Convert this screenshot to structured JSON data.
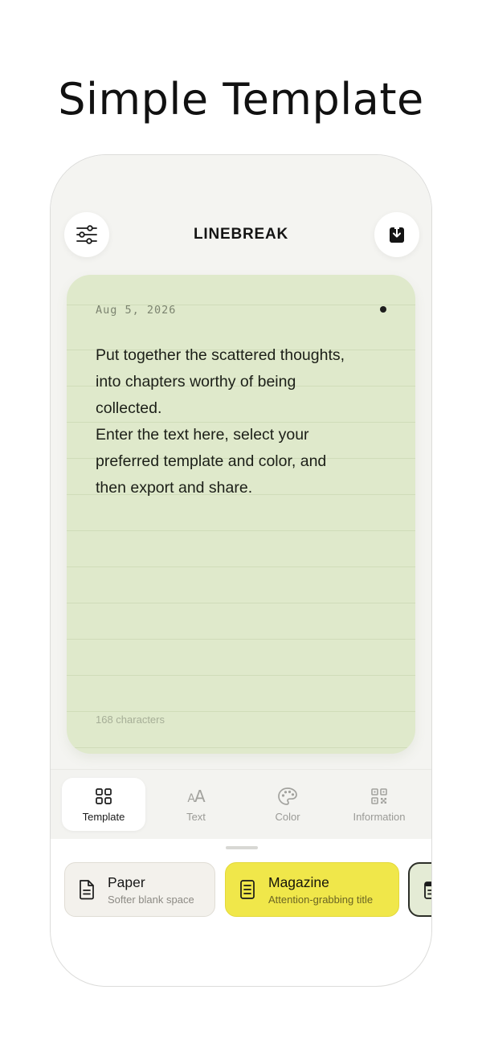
{
  "headline": "Simple Template",
  "app": {
    "title": "LINEBREAK"
  },
  "card": {
    "date": "Aug 5, 2026",
    "text": "Put together the scattered thoughts,\ninto chapters worthy of being\ncollected.\nEnter the text here, select your\npreferred template and color, and\nthen export and share.",
    "char_count": "168 characters",
    "color": "#dfe9cb"
  },
  "tabs": [
    {
      "label": "Template",
      "icon": "grid-icon",
      "active": true
    },
    {
      "label": "Text",
      "icon": "text-size-icon",
      "glyph": "AA"
    },
    {
      "label": "Color",
      "icon": "palette-icon"
    },
    {
      "label": "Information",
      "icon": "qr-code-icon"
    }
  ],
  "templates": [
    {
      "name": "Paper",
      "description": "Softer blank space",
      "icon": "document-icon",
      "color": "#f3f1ec"
    },
    {
      "name": "Magazine",
      "description": "Attention-grabbing title",
      "icon": "magazine-icon",
      "color": "#f0e74a",
      "selected": true
    },
    {
      "name": "",
      "description": "",
      "icon": "notebook-icon",
      "color": "#e4ebd5"
    }
  ],
  "colors": {
    "accent_yellow": "#f0e74a",
    "card_green": "#dfe9cb",
    "background": "#f4f4f1"
  }
}
